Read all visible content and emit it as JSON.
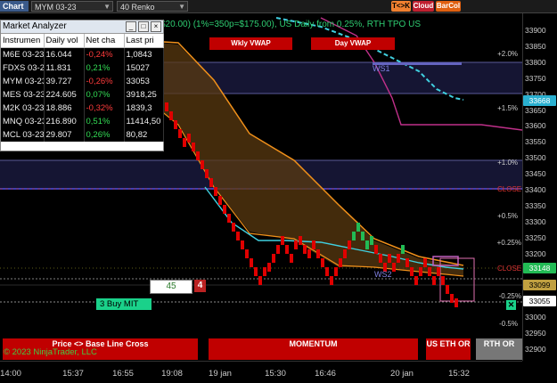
{
  "toolbar": {
    "chart_label": "Chart",
    "instrument": "MYM 03-23",
    "bar_type": "40 Renko",
    "buttons": [
      {
        "label": "T<>K",
        "bg": "#f08030",
        "fg": "#000"
      },
      {
        "label": "Cloud",
        "bg": "#c02030",
        "fg": "#fff"
      },
      {
        "label": "BarCol",
        "bg": "#e06010",
        "fg": "#fff"
      }
    ]
  },
  "header_text": "$20.00) (1%=350p=$175.00), US Daily from 0.25%, RTH TPO US",
  "market_analyzer": {
    "title": "Market Analyzer",
    "columns": [
      "Instrumen",
      "Daily vol",
      "Net cha",
      "Last pri"
    ],
    "rows": [
      {
        "inst": "M6E 03-23",
        "vol": "16.044",
        "chg": "-0,24%",
        "last": "1,0843",
        "dir": "neg"
      },
      {
        "inst": "FDXS 03-2",
        "vol": "11.831",
        "chg": "0,21%",
        "last": "15027",
        "dir": "pos"
      },
      {
        "inst": "MYM 03-23",
        "vol": "39.727",
        "chg": "-0,26%",
        "last": "33053",
        "dir": "neg"
      },
      {
        "inst": "MES 03-23",
        "vol": "224.605",
        "chg": "0,07%",
        "last": "3918,25",
        "dir": "pos"
      },
      {
        "inst": "M2K 03-23",
        "vol": "18.886",
        "chg": "-0,32%",
        "last": "1839,3",
        "dir": "neg"
      },
      {
        "inst": "MNQ 03-23",
        "vol": "216.890",
        "chg": "0,51%",
        "last": "11414,50",
        "dir": "pos"
      },
      {
        "inst": "MCL 03-23",
        "vol": "29.807",
        "chg": "0,26%",
        "last": "80,82",
        "dir": "pos"
      }
    ]
  },
  "vwap_buttons": [
    "Wkly VWAP",
    "Day VWAP"
  ],
  "level_labels": {
    "ws1": "WS1",
    "ws2": "WS2",
    "close": "CLOSE"
  },
  "pct_labels": [
    "+2.0%",
    "+1.5%",
    "+1.0%",
    "+0.5%",
    "+0.25%",
    "-0.25%",
    "-0.5%"
  ],
  "order": {
    "price_offset": "45",
    "quantity": "4",
    "buy_label": "3  Buy MIT",
    "close_icon": "x-icon"
  },
  "price_axis": {
    "ticks": [
      "33900",
      "33850",
      "33800",
      "33750",
      "33700",
      "33650",
      "33600",
      "33550",
      "33500",
      "33450",
      "33400",
      "33350",
      "33300",
      "33250",
      "33200",
      "33150",
      "33100",
      "33050",
      "33000",
      "32950",
      "32900"
    ],
    "last_price": "33668",
    "close_price": "33148",
    "bid_price": "33099",
    "current_price": "33055"
  },
  "time_axis": [
    "14:00",
    "15:37",
    "16:55",
    "19:08",
    "19 jan",
    "15:30",
    "16:46",
    "20 jan",
    "15:32"
  ],
  "bottom_buttons": [
    {
      "label": "Price <> Base Line Cross",
      "color": "#c00000"
    },
    {
      "label": "MOMENTUM",
      "color": "#c00000"
    },
    {
      "label": "US ETH OR",
      "color": "#c00000"
    },
    {
      "label": "RTH OR",
      "color": "#777777"
    }
  ],
  "copyright": "© 2023 NinjaTrader, LLC",
  "colors": {
    "bar_down": "#e00000",
    "bar_up": "#22bb55",
    "cloud": "#5a3a10",
    "vwap_orange": "#f0901a",
    "teal": "#40d0e0",
    "magenta": "#c0308a"
  }
}
